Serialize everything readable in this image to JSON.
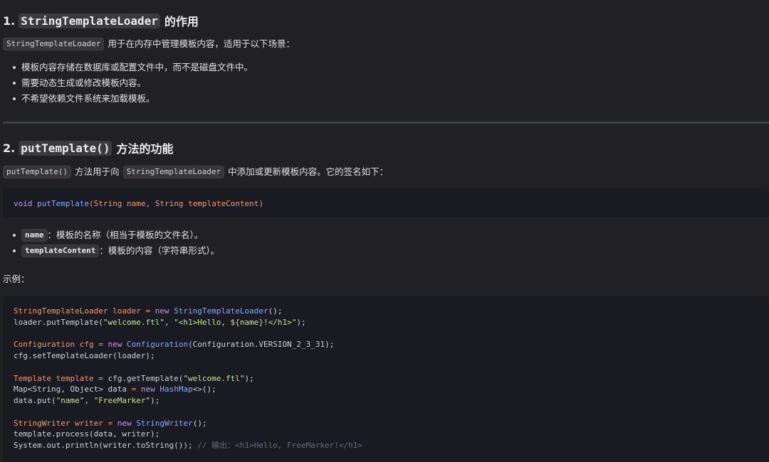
{
  "section1": {
    "number": "1.",
    "code": "StringTemplateLoader",
    "title_suffix": "的作用",
    "intro_code": "StringTemplateLoader",
    "intro_text": "用于在内存中管理模板内容，适用于以下场景：",
    "bullets": [
      "模板内容存储在数据库或配置文件中，而不是磁盘文件中。",
      "需要动态生成或修改模板内容。",
      "不希望依赖文件系统来加载模板。"
    ]
  },
  "section2": {
    "number": "2.",
    "code": "putTemplate()",
    "title_suffix": "方法的功能",
    "intro_code1": "putTemplate()",
    "intro_text1": "方法用于向",
    "intro_code2": "StringTemplateLoader",
    "intro_text2": "中添加或更新模板内容。它的签名如下：",
    "signature": {
      "kw": "void",
      "fn": "putTemplate",
      "open": "(",
      "t1": "String",
      "p1": " name, ",
      "t2": "String",
      "p2": " templateContent",
      "close": ")"
    },
    "params": [
      {
        "code": "name",
        "text": "：模板的名称（相当于模板的文件名）。"
      },
      {
        "code": "templateContent",
        "text": "：模板的内容（字符串形式）。"
      }
    ],
    "example_label": "示例："
  },
  "code_example": {
    "line1": {
      "t": "StringTemplateLoader",
      "v": " loader ",
      "eq": "= ",
      "kw": "new",
      "sp": " ",
      "c": "StringTemplateLoader",
      "e": "();"
    },
    "line2": {
      "a": "loader.putTemplate(",
      "s1": "\"welcome.ftl\"",
      "m": ", ",
      "s2": "\"<h1>Hello, ${name}!</h1>\"",
      "e": ");"
    },
    "line3": {
      "t": "Configuration",
      "v": " cfg ",
      "eq": "= ",
      "kw": "new",
      "sp": " ",
      "c": "Configuration",
      "e": "(Configuration.VERSION_2_3_31);"
    },
    "line4": {
      "a": "cfg.setTemplateLoader(loader);"
    },
    "line5": {
      "t": "Template",
      "v": " template ",
      "eq": "= ",
      "a": "cfg.getTemplate(",
      "s": "\"welcome.ftl\"",
      "e": ");"
    },
    "line6": {
      "a": "Map<String, Object> data ",
      "eq": "= ",
      "kw": "new",
      "sp": " ",
      "c": "HashMap",
      "e": "<>();"
    },
    "line7": {
      "a": "data.put(",
      "s1": "\"name\"",
      "m": ", ",
      "s2": "\"FreeMarker\"",
      "e": ");"
    },
    "line8": {
      "t": "StringWriter",
      "v": " writer ",
      "eq": "= ",
      "kw": "new",
      "sp": " ",
      "c": "StringWriter",
      "e": "();"
    },
    "line9": {
      "a": "template.process(data, writer);"
    },
    "line10": {
      "a": "System.out.println(writer.toString()); ",
      "cm": "// 输出：<h1>Hello, FreeMarker!</h1>"
    }
  }
}
